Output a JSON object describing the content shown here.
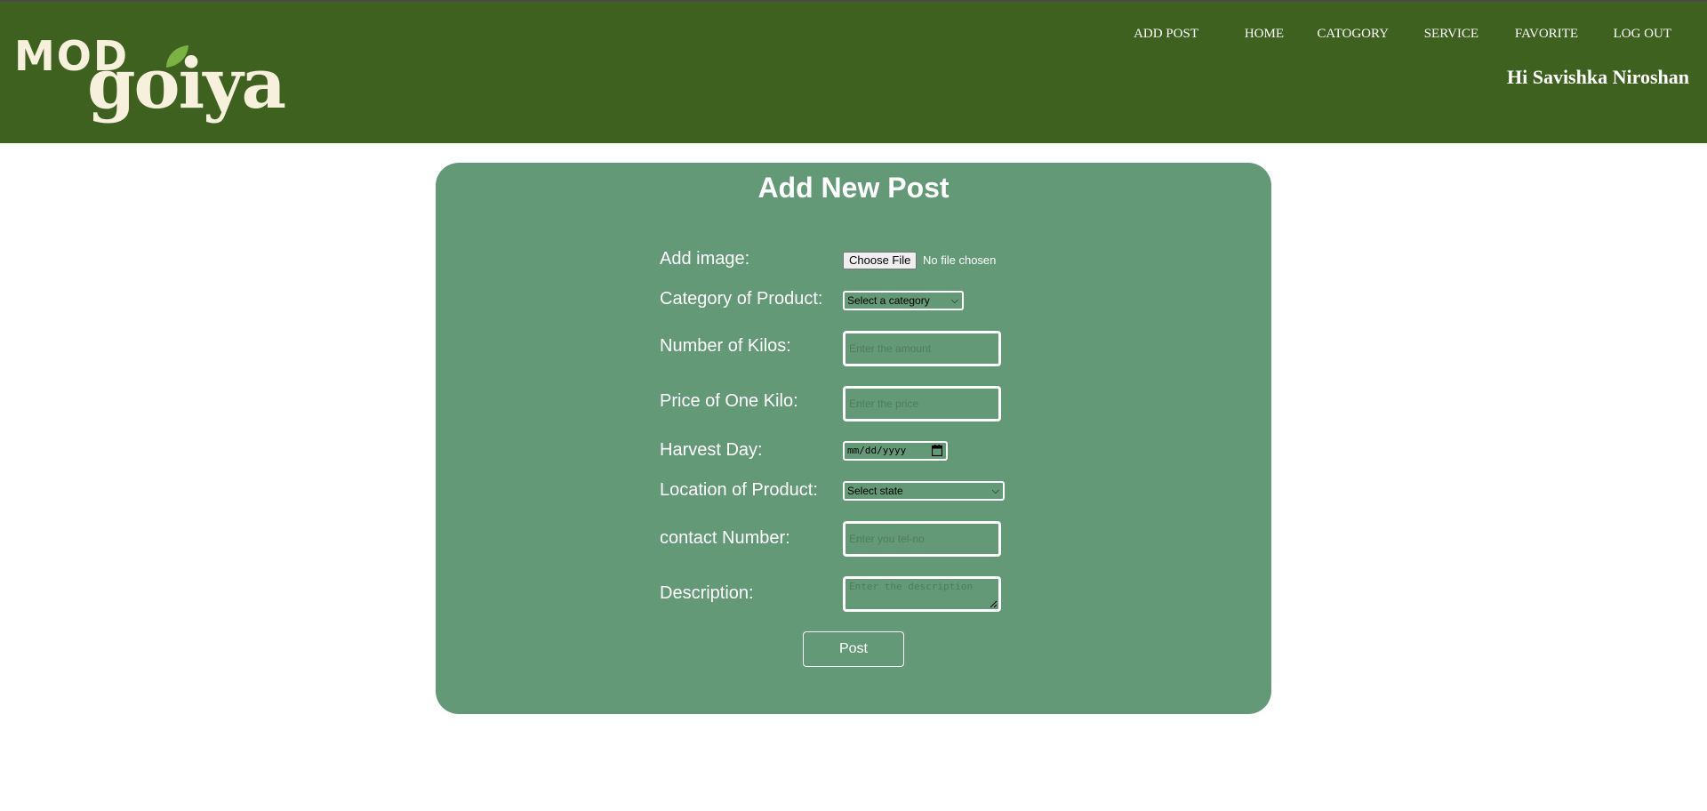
{
  "brand": {
    "logo_top": "MOD",
    "logo_bottom": "goiya",
    "bar_color": "#3e6120",
    "card_color": "#649977"
  },
  "nav": {
    "items": [
      {
        "label": "ADD POST"
      },
      {
        "label": "HOME"
      },
      {
        "label": "CATOGORY"
      },
      {
        "label": "SERVICE"
      },
      {
        "label": "FAVORITE"
      },
      {
        "label": "LOG OUT"
      }
    ],
    "greeting": "Hi Savishka Niroshan"
  },
  "form": {
    "title": "Add New Post",
    "image": {
      "label": "Add image:",
      "button": "Choose File",
      "status": "No file chosen"
    },
    "category": {
      "label": "Category of Product:",
      "selected": "Select a category"
    },
    "kilos": {
      "label": "Number of Kilos:",
      "placeholder": "Enter the amount"
    },
    "price": {
      "label": "Price of One Kilo:",
      "placeholder": "Enter the price"
    },
    "harvest": {
      "label": "Harvest Day:",
      "placeholder": "mm/dd/yyyy"
    },
    "location": {
      "label": "Location of Product:",
      "selected": "Select state"
    },
    "contact": {
      "label": "contact Number:",
      "placeholder": "Enter you tel-no"
    },
    "description": {
      "label": "Description:",
      "placeholder": "Enter the description"
    },
    "submit": "Post"
  }
}
